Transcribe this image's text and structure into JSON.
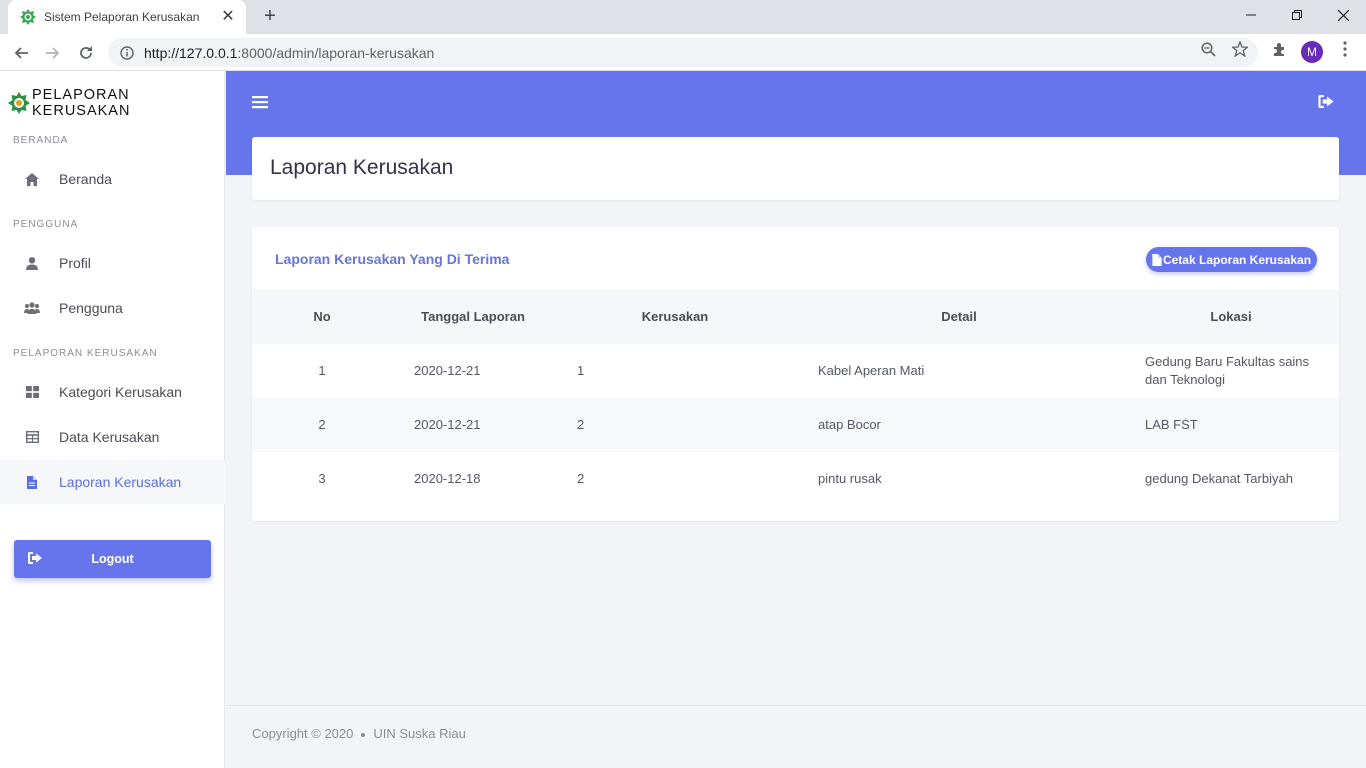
{
  "browser": {
    "tab_title": "Sistem Pelaporan Kerusakan",
    "url_host": "http://127.0.0.1",
    "url_path": ":8000/admin/laporan-kerusakan",
    "profile_initial": "M"
  },
  "sidebar": {
    "brand": "PELAPORAN KERUSAKAN",
    "sections": [
      {
        "label": "BERANDA",
        "items": [
          {
            "label": "Beranda",
            "icon": "home-icon"
          }
        ]
      },
      {
        "label": "PENGGUNA",
        "items": [
          {
            "label": "Profil",
            "icon": "user-icon"
          },
          {
            "label": "Pengguna",
            "icon": "users-icon"
          }
        ]
      },
      {
        "label": "PELAPORAN KERUSAKAN",
        "items": [
          {
            "label": "Kategori Kerusakan",
            "icon": "grid-icon"
          },
          {
            "label": "Data Kerusakan",
            "icon": "table-icon"
          },
          {
            "label": "Laporan Kerusakan",
            "icon": "file-icon",
            "active": true
          }
        ]
      }
    ],
    "logout_label": "Logout"
  },
  "header": {
    "title": "Laporan Kerusakan"
  },
  "report": {
    "title": "Laporan Kerusakan Yang Di Terima",
    "print_label": "Cetak Laporan Kerusakan",
    "columns": [
      "No",
      "Tanggal Laporan",
      "Kerusakan",
      "Detail",
      "Lokasi"
    ],
    "rows": [
      {
        "no": "1",
        "tanggal": "2020-12-21",
        "kerusakan": "1",
        "detail": "Kabel Aperan Mati",
        "lokasi_line1": "Gedung Baru Fakultas sains",
        "lokasi_line2": "dan Teknologi"
      },
      {
        "no": "2",
        "tanggal": "2020-12-21",
        "kerusakan": "2",
        "detail": "atap Bocor",
        "lokasi_line1": "LAB FST",
        "lokasi_line2": ""
      },
      {
        "no": "3",
        "tanggal": "2020-12-18",
        "kerusakan": "2",
        "detail": "pintu rusak",
        "lokasi_line1": "gedung Dekanat Tarbiyah",
        "lokasi_line2": ""
      }
    ]
  },
  "footer": {
    "copyright": "Copyright © 2020",
    "org": "UIN Suska Riau"
  },
  "colors": {
    "accent": "#6675ec",
    "active_text": "#5a6ee0",
    "title_text": "#6675d8"
  }
}
